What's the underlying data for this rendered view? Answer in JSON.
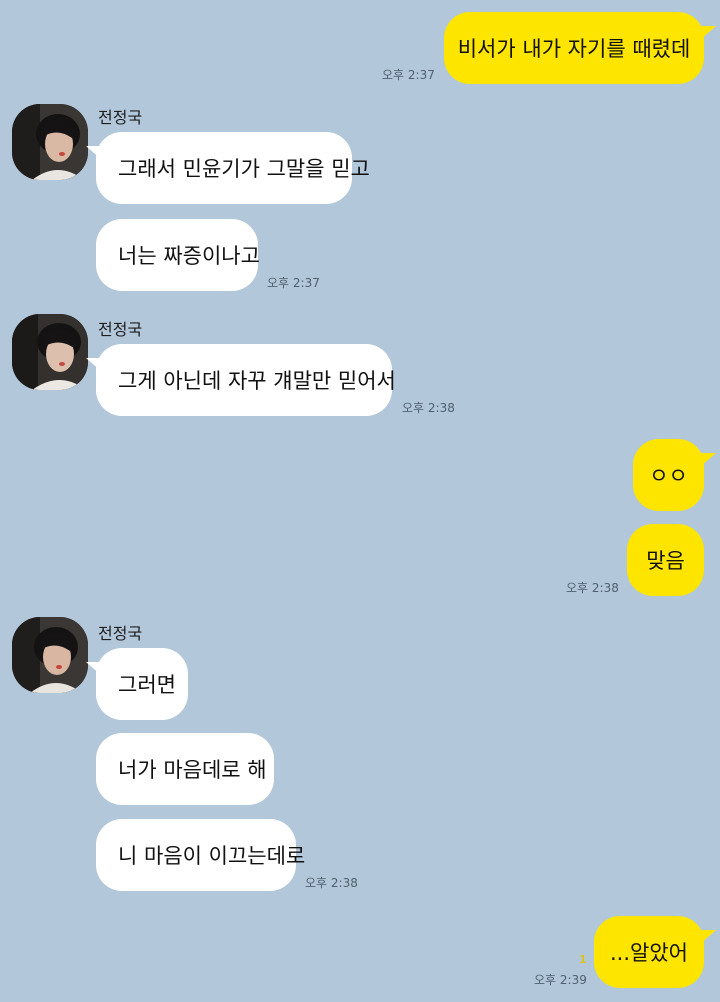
{
  "chat": {
    "contact_name": "전정국",
    "messages": [
      {
        "text": "비서가 내가 자기를 때렸데",
        "time": "오후 2:37"
      },
      {
        "text": "그래서 민윤기가 그말을 믿고"
      },
      {
        "text": "너는 짜증이나고",
        "time": "오후 2:37"
      },
      {
        "text": "그게 아닌데 자꾸 걔말만 믿어서",
        "time": "오후 2:38"
      },
      {
        "text": "ㅇㅇ"
      },
      {
        "text": "맞음",
        "time": "오후 2:38"
      },
      {
        "text": "그러면"
      },
      {
        "text": "너가 마음데로 해"
      },
      {
        "text": "니 마음이 이끄는데로",
        "time": "오후 2:38"
      },
      {
        "text": "...알았어",
        "time": "오후 2:39",
        "unread": "1"
      }
    ]
  },
  "colors": {
    "background": "#b2c7da",
    "outgoing_bubble": "#fee500",
    "incoming_bubble": "#ffffff",
    "unread_count": "#d9c21a"
  }
}
